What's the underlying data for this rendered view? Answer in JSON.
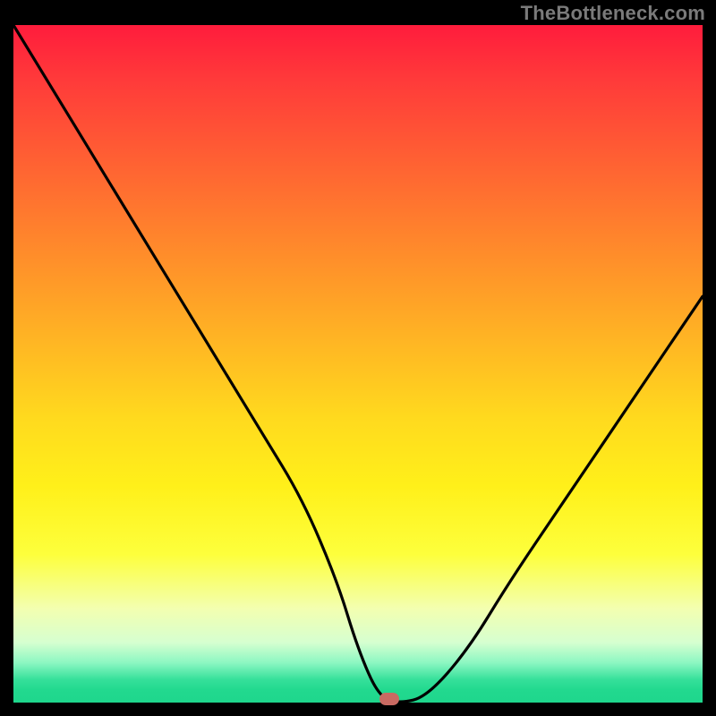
{
  "watermark": "TheBottleneck.com",
  "chart_data": {
    "type": "line",
    "title": "",
    "xlabel": "",
    "ylabel": "",
    "xlim": [
      0,
      100
    ],
    "ylim": [
      0,
      100
    ],
    "grid": false,
    "legend": false,
    "series": [
      {
        "name": "bottleneck-curve",
        "x": [
          0,
          6,
          12,
          18,
          24,
          30,
          36,
          42,
          47,
          50,
          53,
          56,
          60,
          66,
          72,
          80,
          90,
          100
        ],
        "values": [
          100,
          90,
          80,
          70,
          60,
          50,
          40,
          30,
          18,
          8,
          1,
          0,
          1,
          8,
          18,
          30,
          45,
          60
        ]
      }
    ],
    "marker": {
      "x": 54.5,
      "y": 0.7,
      "color": "#c96a62"
    },
    "gradient_bg": "red-to-green-vertical"
  }
}
